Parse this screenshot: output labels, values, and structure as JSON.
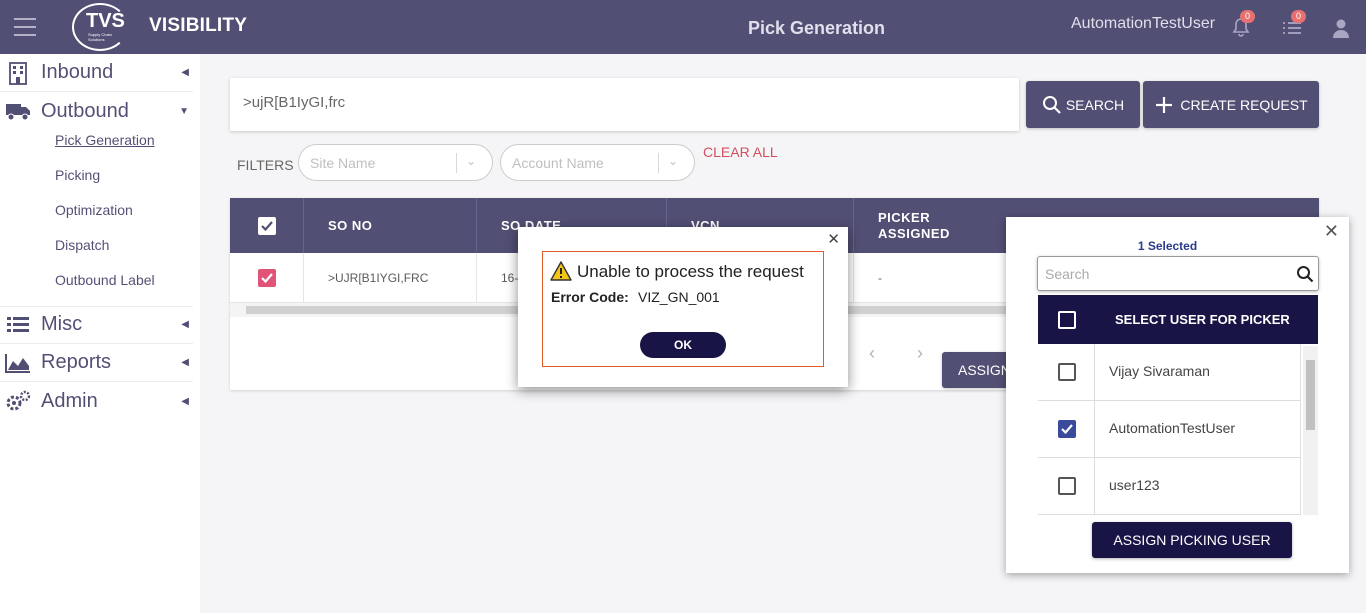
{
  "header": {
    "logo_text": "TVS",
    "logo_subtext": "Supply Chain Solutions",
    "brand": "VISIBILITY",
    "page_title": "Pick Generation",
    "username": "AutomationTestUser",
    "notifications_count": "0",
    "tasks_count": "0"
  },
  "sidebar": {
    "sections": [
      {
        "label": "Inbound",
        "icon": "building-icon"
      },
      {
        "label": "Outbound",
        "icon": "truck-icon"
      },
      {
        "label": "Misc",
        "icon": "list-icon"
      },
      {
        "label": "Reports",
        "icon": "area-chart-icon"
      },
      {
        "label": "Admin",
        "icon": "gears-icon"
      }
    ],
    "outbound_items": [
      "Pick Generation",
      "Picking",
      "Optimization",
      "Dispatch",
      "Outbound Label"
    ]
  },
  "search": {
    "value": ">ujR[B1IyGI,frc",
    "search_button": "SEARCH",
    "create_button": "CREATE REQUEST"
  },
  "filters": {
    "label": "FILTERS",
    "site_placeholder": "Site Name",
    "account_placeholder": "Account Name",
    "clear_all": "CLEAR ALL"
  },
  "table": {
    "columns": [
      "SO NO",
      "SO DATE",
      "VCN",
      "PICKER\nASSIGNED"
    ],
    "rows": [
      {
        "so_no": ">UJR[B1IYGI,FRC",
        "so_date": "16-",
        "picker": "-"
      }
    ],
    "assign_button": "ASSIGN"
  },
  "picker_panel": {
    "selected_text": "1 Selected",
    "search_placeholder": "Search",
    "header": "SELECT USER FOR PICKER",
    "users": [
      {
        "name": "Vijay Sivaraman",
        "checked": false
      },
      {
        "name": "AutomationTestUser",
        "checked": true
      },
      {
        "name": "user123",
        "checked": false
      }
    ],
    "assign_button": "ASSIGN PICKING USER"
  },
  "modal": {
    "message": "Unable to process the request",
    "code_label": "Error Code:",
    "code_value": "VIZ_GN_001",
    "ok_label": "OK"
  },
  "colors": {
    "primary": "#191446",
    "danger": "#c0152a",
    "checkbox_red": "#d81b4a",
    "checkbox_blue": "#3b4b9c",
    "modal_border": "#e05a2a"
  }
}
